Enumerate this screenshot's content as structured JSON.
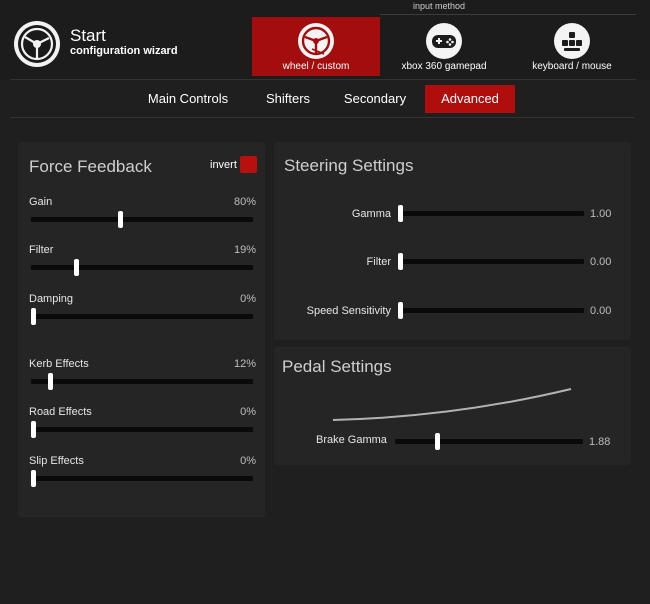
{
  "header": {
    "title": "Start",
    "subtitle": "configuration wizard",
    "input_method_label": "input method",
    "methods": [
      {
        "label": "wheel / custom",
        "icon": "steering-wheel-icon",
        "active": true
      },
      {
        "label": "xbox 360 gamepad",
        "icon": "gamepad-icon",
        "active": false
      },
      {
        "label": "keyboard / mouse",
        "icon": "keyboard-icon",
        "active": false
      }
    ]
  },
  "tabs": [
    {
      "label": "Main Controls",
      "active": false
    },
    {
      "label": "Shifters",
      "active": false
    },
    {
      "label": "Secondary",
      "active": false
    },
    {
      "label": "Advanced",
      "active": true
    }
  ],
  "force_feedback": {
    "title": "Force Feedback",
    "invert_label": "invert",
    "invert_checked": true,
    "sliders": [
      {
        "label": "Gain",
        "value": "80%",
        "position": 0.4
      },
      {
        "label": "Filter",
        "value": "19%",
        "position": 0.2
      },
      {
        "label": "Damping",
        "value": "0%",
        "position": 0.0
      },
      {
        "label": "Kerb Effects",
        "value": "12%",
        "position": 0.08
      },
      {
        "label": "Road Effects",
        "value": "0%",
        "position": 0.0
      },
      {
        "label": "Slip Effects",
        "value": "0%",
        "position": 0.0
      }
    ]
  },
  "steering": {
    "title": "Steering Settings",
    "sliders": [
      {
        "label": "Gamma",
        "value": "1.00",
        "position": 0.0
      },
      {
        "label": "Filter",
        "value": "0.00",
        "position": 0.0
      },
      {
        "label": "Speed Sensitivity",
        "value": "0.00",
        "position": 0.0
      }
    ]
  },
  "pedal": {
    "title": "Pedal Settings",
    "slider": {
      "label": "Brake Gamma",
      "value": "1.88",
      "position": 0.22
    }
  },
  "colors": {
    "accent": "#b00d0d",
    "background": "#1f1f1f",
    "panel": "#252525",
    "track": "#0a0a0a"
  }
}
